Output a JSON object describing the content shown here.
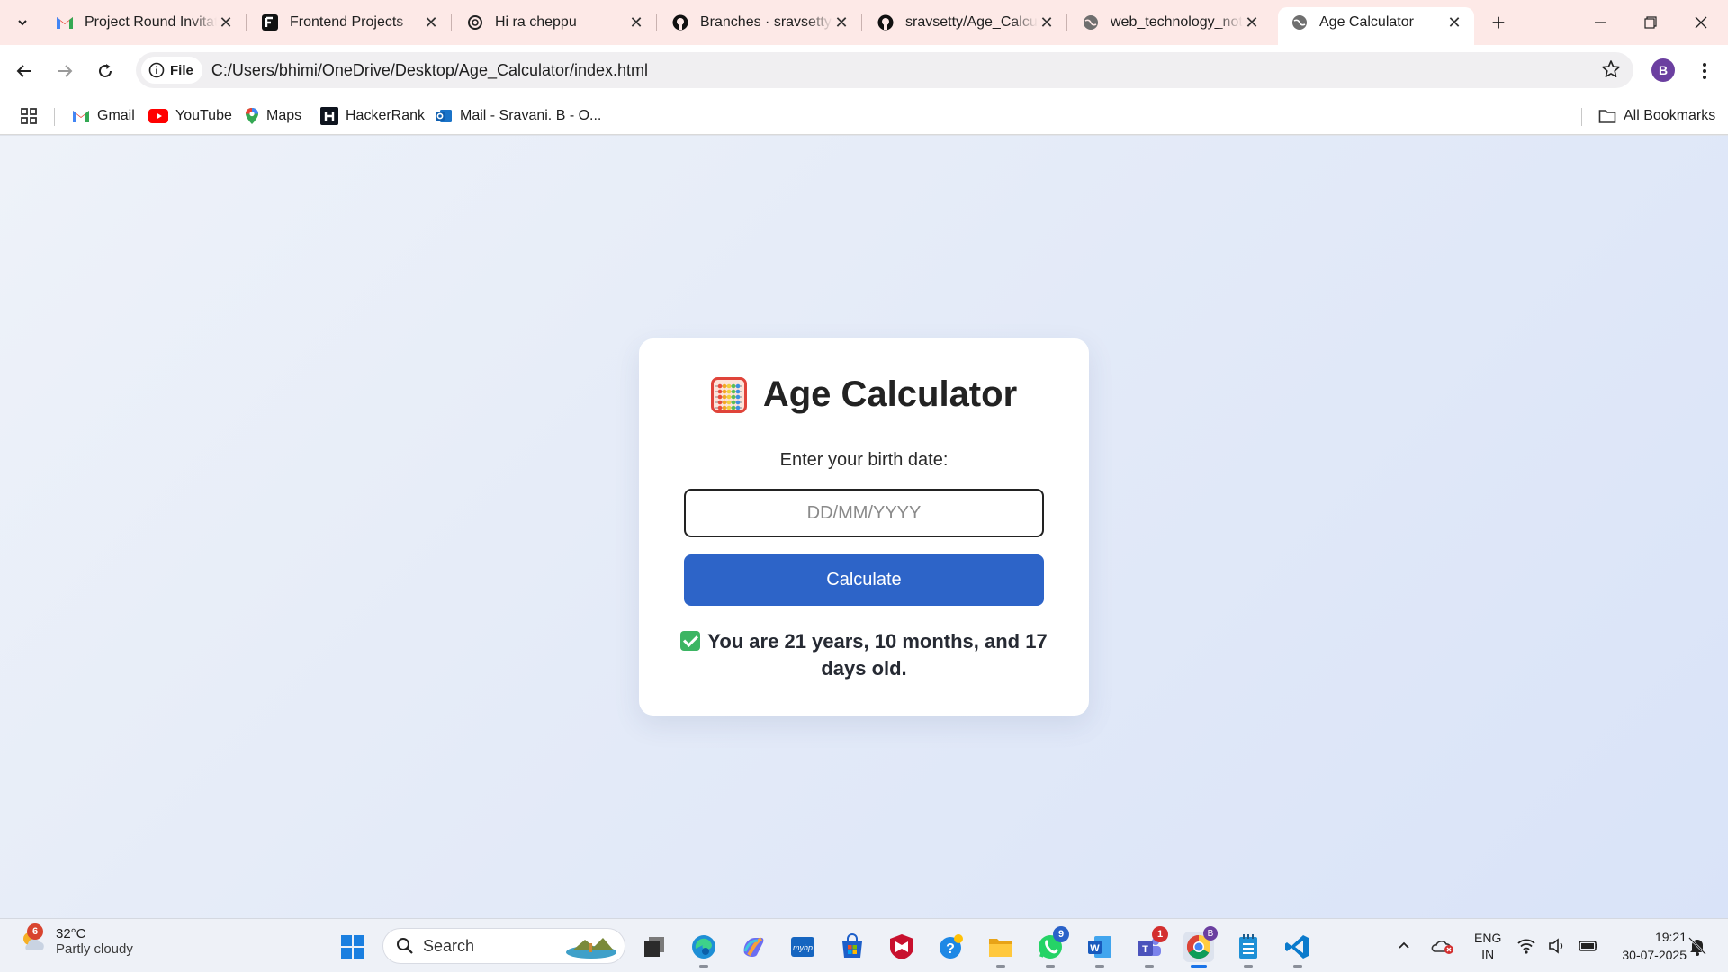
{
  "browser": {
    "tabs": [
      {
        "title": "Project Round Invitat",
        "icon": "gmail-icon",
        "active": false
      },
      {
        "title": "Frontend Projects",
        "icon": "frontend-mentor-icon",
        "active": false
      },
      {
        "title": "Hi ra cheppu",
        "icon": "chatgpt-icon",
        "active": false
      },
      {
        "title": "Branches · sravsetty/A",
        "icon": "github-icon",
        "active": false
      },
      {
        "title": "sravsetty/Age_Calcul",
        "icon": "github-icon",
        "active": false
      },
      {
        "title": "web_technology_not",
        "icon": "globe-icon",
        "active": false
      },
      {
        "title": "Age Calculator",
        "icon": "globe-icon",
        "active": true
      }
    ],
    "omnibox": {
      "scheme_chip": "File",
      "url": "C:/Users/bhimi/OneDrive/Desktop/Age_Calculator/index.html"
    },
    "profile_initial": "B",
    "bookmarks": [
      {
        "label": "Gmail",
        "icon": "gmail-icon"
      },
      {
        "label": "YouTube",
        "icon": "youtube-icon"
      },
      {
        "label": "Maps",
        "icon": "maps-icon"
      },
      {
        "label": "HackerRank",
        "icon": "hackerrank-icon"
      },
      {
        "label": "Mail - Sravani. B - O...",
        "icon": "outlook-icon"
      }
    ],
    "all_bookmarks": "All Bookmarks"
  },
  "page": {
    "title": "Age Calculator",
    "title_icon": "abacus-icon",
    "birth_label": "Enter your birth date:",
    "date_placeholder": "DD/MM/YYYY",
    "calculate_label": "Calculate",
    "result_text": "You are 21 years, 10 months, and 17 days old.",
    "colors": {
      "button": "#2d64c8",
      "check": "#3cb563"
    }
  },
  "taskbar": {
    "weather": {
      "badge": "6",
      "temp": "32°C",
      "desc": "Partly cloudy"
    },
    "search_label": "Search",
    "apps": [
      {
        "name": "windows-start-icon"
      },
      {
        "name": "file-manager-icon"
      },
      {
        "name": "edge-icon"
      },
      {
        "name": "copilot-icon"
      },
      {
        "name": "myhp-icon"
      },
      {
        "name": "microsoft-store-icon"
      },
      {
        "name": "mcafee-icon"
      },
      {
        "name": "tips-icon"
      },
      {
        "name": "file-explorer-icon"
      },
      {
        "name": "whatsapp-icon",
        "badge": "9"
      },
      {
        "name": "word-icon"
      },
      {
        "name": "teams-icon",
        "badge": "1"
      },
      {
        "name": "chrome-icon"
      },
      {
        "name": "notepad-icon"
      },
      {
        "name": "vscode-icon"
      }
    ],
    "lang_top": "ENG",
    "lang_bottom": "IN",
    "time": "19:21",
    "date": "30-07-2025"
  }
}
